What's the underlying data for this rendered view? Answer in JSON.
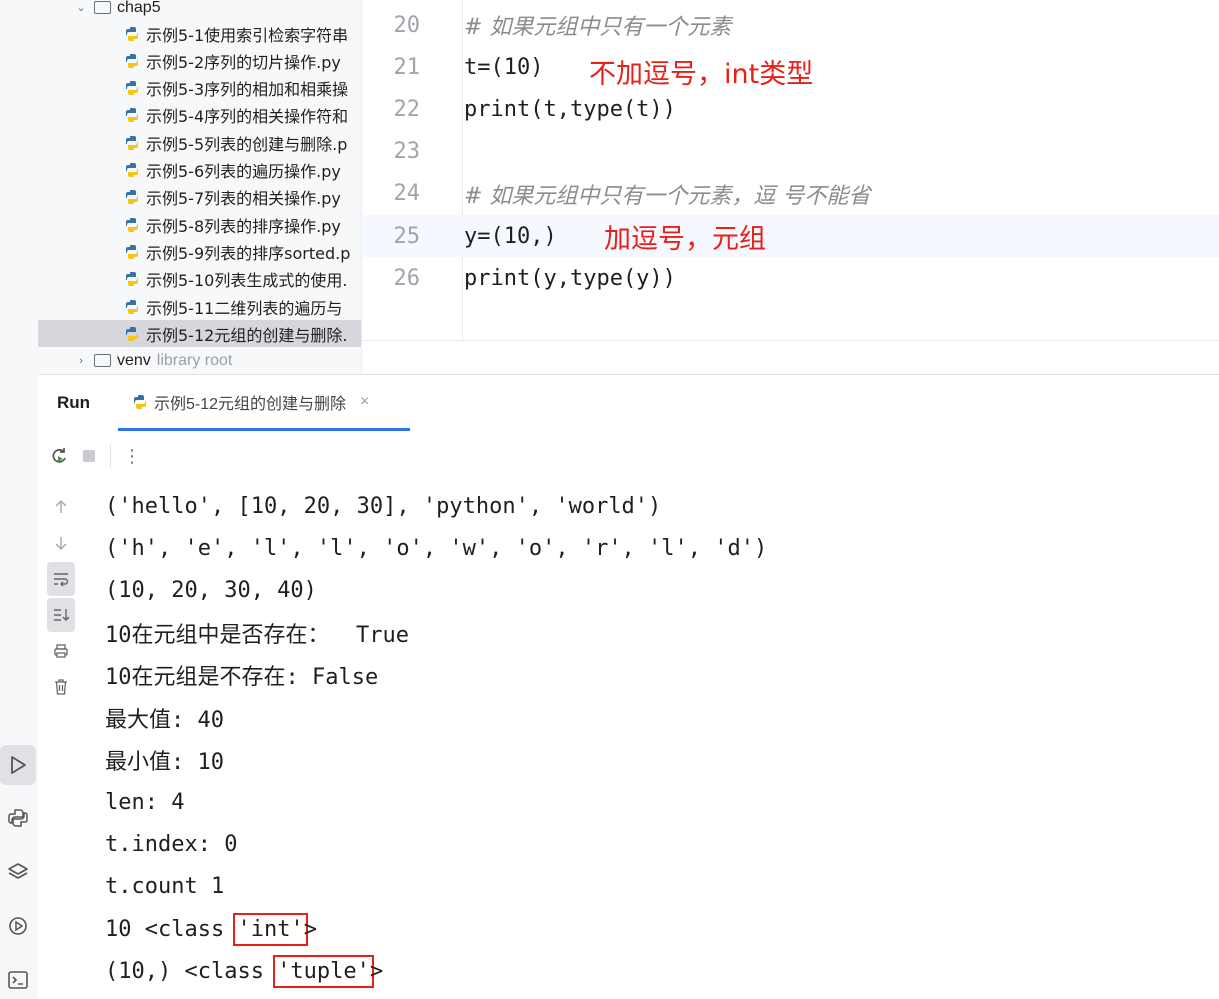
{
  "project_tree": {
    "folder_chap5": "chap5",
    "files": [
      "示例5-1使用索引检索字符串",
      "示例5-2序列的切片操作.py",
      "示例5-3序列的相加和相乘操",
      "示例5-4序列的相关操作符和",
      "示例5-5列表的创建与删除.p",
      "示例5-6列表的遍历操作.py",
      "示例5-7列表的相关操作.py",
      "示例5-8列表的排序操作.py",
      "示例5-9列表的排序sorted.p",
      "示例5-10列表生成式的使用.",
      "示例5-11二维列表的遍历与",
      "示例5-12元组的创建与删除."
    ],
    "selected_index": 11,
    "folder_venv": "venv",
    "venv_note": "library root"
  },
  "editor": {
    "lines": [
      {
        "num": "20",
        "text": "# 如果元组中只有一个元素"
      },
      {
        "num": "21",
        "text": "t=(10)"
      },
      {
        "num": "22",
        "text": "print(t,type(t))"
      },
      {
        "num": "23",
        "text": ""
      },
      {
        "num": "24",
        "text": "# 如果元组中只有一个元素，逗 号不能省"
      },
      {
        "num": "25",
        "text": "y=(10,)"
      },
      {
        "num": "26",
        "text": "print(y,type(y))"
      }
    ],
    "annotation_1": "不加逗号，int类型",
    "annotation_2": "加逗号，元组"
  },
  "run_panel": {
    "title": "Run",
    "tab_label": "示例5-12元组的创建与删除",
    "tab_close": "×",
    "more": "⋮",
    "output": [
      "('hello', [10, 20, 30], 'python', 'world')",
      "('h', 'e', 'l', 'l', 'o', 'w', 'o', 'r', 'l', 'd')",
      "(10, 20, 30, 40)",
      "10在元组中是否存在：  True",
      "10在元组是不存在: False",
      "最大值: 40",
      "最小值: 10",
      "len: 4",
      "t.index: 0",
      "t.count 1"
    ],
    "out_int_prefix": "10 <class ",
    "out_int_type": "'int'",
    "out_int_suffix": ">",
    "out_tuple_prefix": "(10,) <class ",
    "out_tuple_type": "'tuple'",
    "out_tuple_suffix": ">"
  },
  "colors": {
    "annotation_red": "#e8201a",
    "accent_blue": "#3574f0",
    "number_blue": "#1750eb",
    "paren_highlight": "#93d9d9"
  }
}
